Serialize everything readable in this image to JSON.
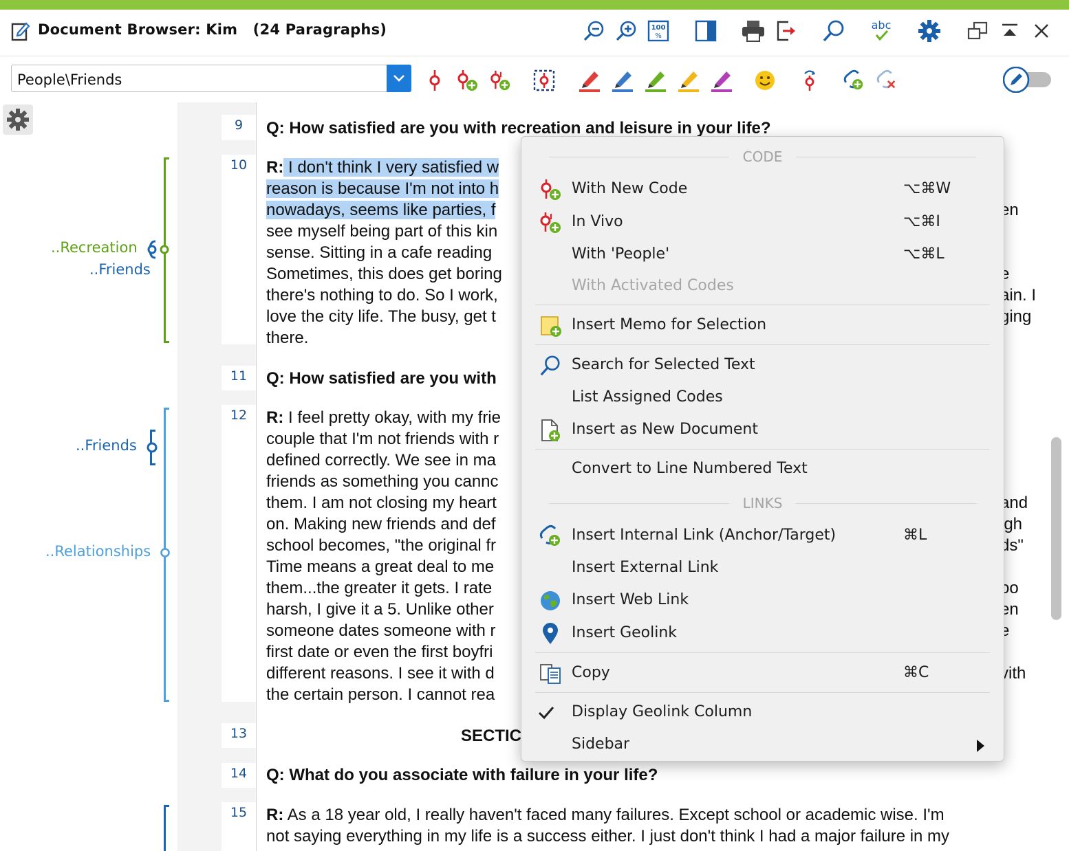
{
  "window": {
    "title": "Document Browser: Kim   (24 Paragraphs)",
    "accent_color": "#8cc63f",
    "toolbar_icons": [
      "zoom-out-icon",
      "zoom-in-icon",
      "zoom-100-icon",
      "panel-toggle-icon",
      "print-icon",
      "export-icon",
      "search-icon",
      "spellcheck-icon",
      "settings-icon",
      "undock-icon",
      "collapse-icon",
      "close-icon"
    ],
    "spellcheck_text": "abc",
    "zoom100_text": "100"
  },
  "code_toolbar": {
    "selected_code": "People\\Friends",
    "icons": [
      "code-icon",
      "code-new-icon",
      "code-invivo-icon",
      "code-selection-icon",
      "highlight-red-icon",
      "highlight-blue-icon",
      "highlight-green-icon",
      "highlight-yellow-icon",
      "highlight-purple-icon",
      "emoticon-icon",
      "undo-code-icon",
      "add-link-icon",
      "remove-link-icon",
      "edit-mode-icon"
    ],
    "edit_toggle_on": false
  },
  "margin_codes": [
    {
      "label": "..Recreation",
      "color": "#5ea018"
    },
    {
      "label": "..Friends",
      "color": "#1a65b0"
    },
    {
      "label": "..Friends",
      "color": "#1a65b0"
    },
    {
      "label": "..Relationships",
      "color": "#4f9fdb"
    }
  ],
  "paragraph_numbers": [
    "9",
    "10",
    "11",
    "12",
    "13",
    "14",
    "15"
  ],
  "document": {
    "p9": "Q: How satisfied are you with recreation and leisure in your life?",
    "p10_lines": [
      {
        "r": "R:",
        "hl": " I don't think I very satisfied w",
        "rest": "",
        "tail": ""
      },
      {
        "r": "",
        "hl": "reason is because I'm not into h",
        "rest": "",
        "tail": ""
      },
      {
        "r": "",
        "hl": "nowadays, seems like parties, f",
        "rest": "",
        "tail": "en"
      },
      {
        "r": "",
        "hl": "",
        "rest": "see myself being part of this kin",
        "tail": ""
      },
      {
        "r": "",
        "hl": "",
        "rest": "sense. Sitting in a cafe reading",
        "tail": ""
      },
      {
        "r": "",
        "hl": "",
        "rest": "Sometimes, this does get boring",
        "tail": "e"
      },
      {
        "r": "",
        "hl": "",
        "rest": "there's nothing to do. So I work,",
        "tail": "ain. I"
      },
      {
        "r": "",
        "hl": "",
        "rest": "love the city life. The busy, get t",
        "tail": "ging"
      },
      {
        "r": "",
        "hl": "",
        "rest": "there.",
        "tail": ""
      }
    ],
    "p11": "Q: How satisfied are you with",
    "p12_lines": [
      {
        "r": "R:",
        "rest": " I feel pretty okay, with my frie",
        "tail": ""
      },
      {
        "r": "",
        "rest": "couple that I'm not friends with r",
        "tail": "."
      },
      {
        "r": "",
        "rest": "defined correctly. We see in ma",
        "tail": ""
      },
      {
        "r": "",
        "rest": "friends as something you cannc",
        "tail": ""
      },
      {
        "r": "",
        "rest": "them. I am not closing my heart",
        "tail": "and"
      },
      {
        "r": "",
        "rest": "on. Making new friends and def",
        "tail": "igh"
      },
      {
        "r": "",
        "rest": "school becomes, \"the original fr",
        "tail": "ds\""
      },
      {
        "r": "",
        "rest": "Time means a great deal to me",
        "tail": ""
      },
      {
        "r": "",
        "rest": "them...the greater it gets. I rate",
        "tail": "oo"
      },
      {
        "r": "",
        "rest": "harsh, I give it a 5. Unlike other",
        "tail": "en"
      },
      {
        "r": "",
        "rest": "someone dates someone with r",
        "tail": "e"
      },
      {
        "r": "",
        "rest": "first date or even the first boyfri",
        "tail": ""
      },
      {
        "r": "",
        "rest": "different reasons. I see it with d",
        "tail": "vith"
      },
      {
        "r": "",
        "rest": "the certain person. I cannot rea",
        "tail": ""
      }
    ],
    "p13": "SECTIC",
    "p14": "Q: What do you associate with failure in your life?",
    "p15_lines": [
      {
        "r": "R:",
        "rest": " As a 18 year old, I really haven't faced many failures. Except school or academic wise. I'm"
      },
      {
        "r": "",
        "rest": "not saying everything in my life is a success either. I just don't think I had a major failure in my"
      }
    ]
  },
  "context_menu": {
    "code_header": "CODE",
    "links_header": "LINKS",
    "items": {
      "new_code": {
        "label": "With New Code",
        "shortcut": "⌥⌘W",
        "icon": "code-new-icon"
      },
      "in_vivo": {
        "label": "In Vivo",
        "shortcut": "⌥⌘I",
        "icon": "code-invivo-icon"
      },
      "with_people": {
        "label": "With 'People'",
        "shortcut": "⌥⌘L"
      },
      "activated": {
        "label": "With Activated Codes"
      },
      "memo": {
        "label": "Insert Memo for Selection",
        "icon": "memo-icon"
      },
      "search": {
        "label": "Search for Selected Text",
        "icon": "search-icon"
      },
      "list_codes": {
        "label": "List Assigned Codes"
      },
      "new_doc": {
        "label": "Insert as New Document",
        "icon": "new-document-icon"
      },
      "convert": {
        "label": "Convert to Line Numbered Text"
      },
      "internal_link": {
        "label": "Insert Internal Link (Anchor/Target)",
        "shortcut": "⌘L",
        "icon": "internal-link-icon"
      },
      "external_link": {
        "label": "Insert External Link"
      },
      "web_link": {
        "label": "Insert Web Link",
        "icon": "globe-icon"
      },
      "geolink": {
        "label": "Insert Geolink",
        "icon": "location-pin-icon"
      },
      "copy": {
        "label": "Copy",
        "shortcut": "⌘C",
        "icon": "copy-icon"
      },
      "display_geolink": {
        "label": "Display Geolink Column",
        "checked": true
      },
      "sidebar": {
        "label": "Sidebar",
        "has_submenu": true
      }
    }
  }
}
